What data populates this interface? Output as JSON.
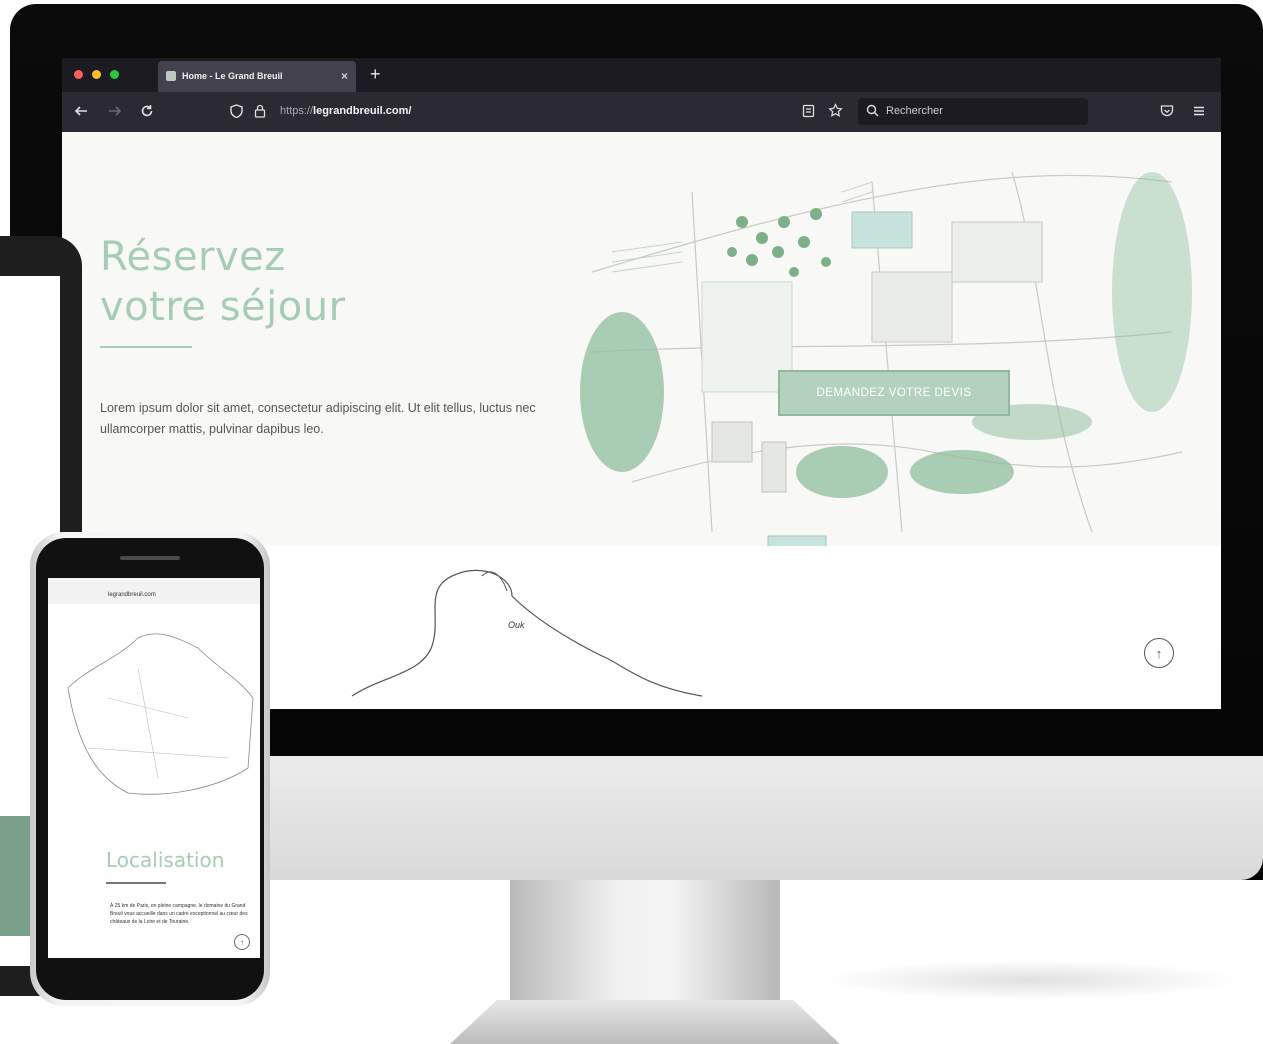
{
  "browser": {
    "tab_title": "Home - Le Grand Breuil",
    "tab_close": "×",
    "new_tab": "+",
    "url_prefix": "https://",
    "url_domain": "legrandbreuil.com/",
    "search_placeholder": "Rechercher",
    "nav_icons": [
      "back-arrow-icon",
      "forward-arrow-icon",
      "reload-icon",
      "shield-icon",
      "lock-icon",
      "reader-icon",
      "bookmark-star-icon",
      "search-icon",
      "pocket-icon",
      "menu-icon"
    ]
  },
  "hero": {
    "title_line1": "Réservez",
    "title_line2": "votre séjour",
    "body": "Lorem ipsum dolor sit amet, consectetur adipiscing elit. Ut elit tellus, luctus nec ullamcorper mattis, pulvinar dapibus leo.",
    "cta_label": "DEMANDEZ VOTRE DEVIS",
    "map_label": "Ouk"
  },
  "scroll_top_icon": "↑",
  "phone": {
    "url": "legrandbreuil.com",
    "section_title": "Localisation",
    "body": "À 25 km de Paris, en pleine campagne, le domaine du Grand Breuil vous accueille dans un cadre exceptionnel au cœur des châteaux de la Loire et de Touraine.",
    "scroll_top_icon": "↑"
  },
  "colors": {
    "accent_green": "#a6cdb3",
    "cta_bg": "#b3d1bd",
    "browser_dark": "#1c1b22",
    "browser_nav": "#2b2a33"
  }
}
